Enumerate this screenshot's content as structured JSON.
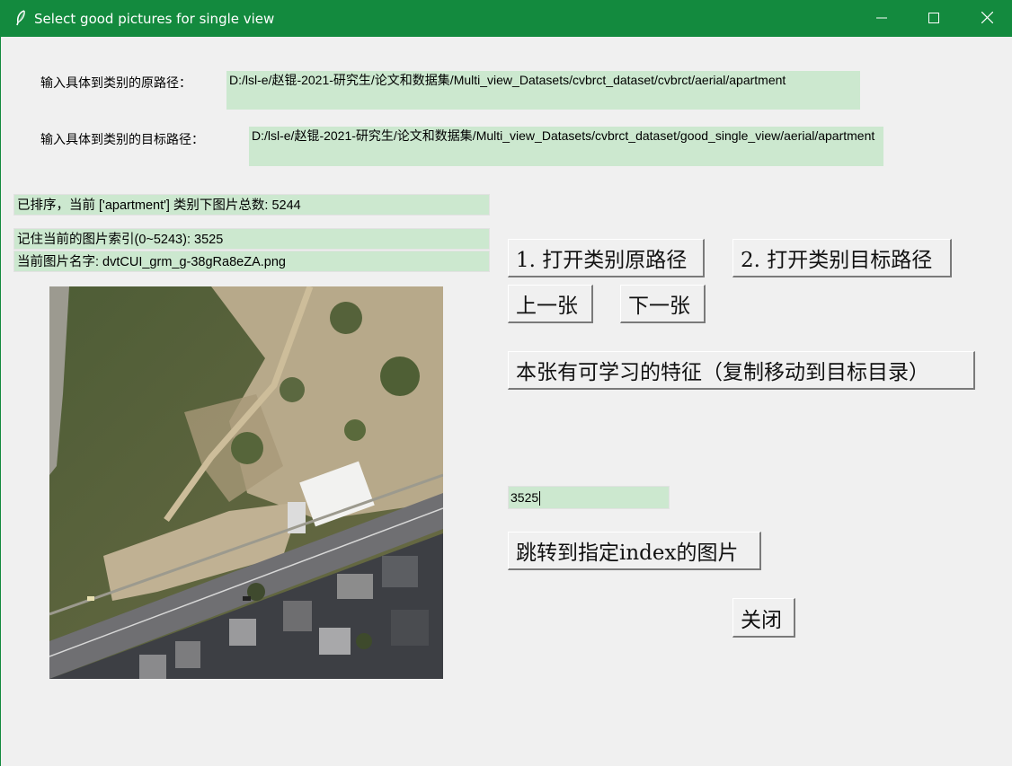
{
  "window": {
    "title": "Select good pictures for single view",
    "icon": "feather-icon",
    "controls": [
      "minimize-icon",
      "maximize-icon",
      "close-icon"
    ],
    "accent_color": "#138a3e"
  },
  "source_path": {
    "label": "输入具体到类别的原路径：",
    "value": "D:/lsl-e/赵锟-2021-研究生/论文和数据集/Multi_view_Datasets/cvbrct_dataset/cvbrct/aerial/apartment"
  },
  "target_path": {
    "label": "输入具体到类别的目标路径：",
    "value": "D:/lsl-e/赵锟-2021-研究生/论文和数据集/Multi_view_Datasets/cvbrct_dataset/good_single_view/aerial/apartment"
  },
  "status": {
    "sorted_total": "已排序，当前 ['apartment'] 类别下图片总数: 5244",
    "current_index": "记住当前的图片索引(0~5243): 3525",
    "current_name": "当前图片名字: dvtCUI_grm_g-38gRa8eZA.png"
  },
  "buttons": {
    "open_source": "1. 打开类别原路径",
    "open_target": "2. 打开类别目标路径",
    "prev": "上一张",
    "next": "下一张",
    "keep": "本张有可学习的特征（复制移动到目标目录）",
    "jump": "跳转到指定index的图片",
    "close": "关闭"
  },
  "jump_input": {
    "value": "3525"
  },
  "field_color": "#cce8cf"
}
